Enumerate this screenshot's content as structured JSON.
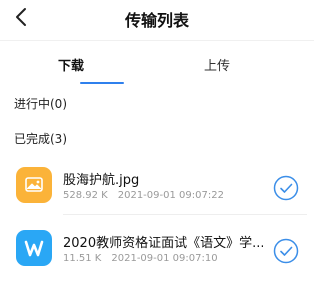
{
  "header": {
    "title": "传输列表",
    "back_icon": "chevron-left-icon"
  },
  "tabs": [
    {
      "label": "下载",
      "active": true
    },
    {
      "label": "上传",
      "active": false
    }
  ],
  "sections": {
    "in_progress": "进行中(0)",
    "completed": "已完成(3)"
  },
  "files": [
    {
      "name": "股海护航.jpg",
      "size": "528.92 K",
      "time": "2021-09-01 09:07:22",
      "icon": "image-file-icon",
      "icon_color": "#fbb339"
    },
    {
      "name": "2020教师资格证面试《语文》学...",
      "size": "11.51 K",
      "time": "2021-09-01 09:07:10",
      "icon": "wps-document-icon",
      "icon_color": "#2aa7f5"
    }
  ],
  "colors": {
    "accent": "#2f80ed",
    "check": "#3b8ee8"
  }
}
